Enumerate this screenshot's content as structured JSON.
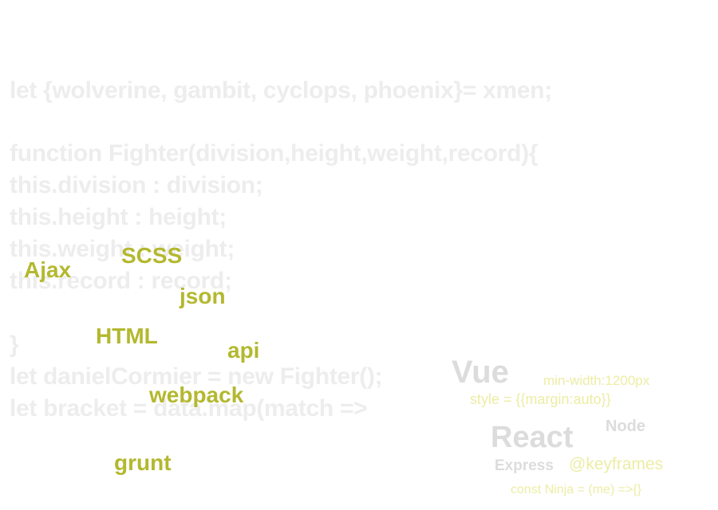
{
  "code_lines": [
    "let {wolverine, gambit, cyclops, phoenix}= xmen;",
    "function Fighter(division,height,weight,record){",
    "this.division : division;",
    "this.height : height;",
    "this.weight : weight;",
    "this.record : record;",
    "}",
    "let danielCormier = new Fighter();",
    "let bracket = data.map(match =>"
  ],
  "green_tags": {
    "ajax": "Ajax",
    "scss": "SCSS",
    "json": "json",
    "html": "HTML",
    "api": "api",
    "webpack": "webpack",
    "grunt": "grunt"
  },
  "right_cloud": {
    "vue": "Vue",
    "min_width": "min-width:1200px",
    "style": "style = {{margin:auto}}",
    "react": "React",
    "node": "Node",
    "express": "Express",
    "keyframes": "@keyframes",
    "ninja": "const Ninja = (me) =>{}"
  },
  "colors": {
    "code_text": "#ededed",
    "green_tag": "#b3b82f",
    "grey_tag": "#dcdcdc",
    "yellow_tag": "#eceda5"
  }
}
